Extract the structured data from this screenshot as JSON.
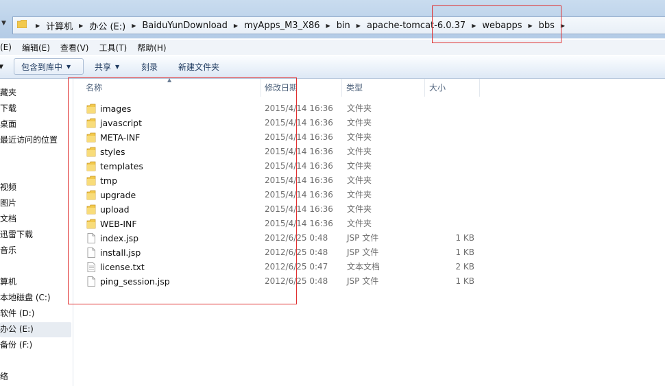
{
  "address": {
    "crumbs": [
      "计算机",
      "办公 (E:)",
      "BaiduYunDownload",
      "myApps_M3_X86",
      "bin",
      "apache-tomcat-6.0.37",
      "webapps",
      "bbs"
    ]
  },
  "menu": {
    "items": [
      "(E)",
      "编辑(E)",
      "查看(V)",
      "工具(T)",
      "帮助(H)"
    ]
  },
  "toolbar": {
    "include_library": "包含到库中",
    "share": "共享",
    "burn": "刻录",
    "new_folder": "新建文件夹"
  },
  "sidebar": {
    "items": [
      "藏夹",
      "下载",
      "桌面",
      "最近访问的位置",
      "",
      "视频",
      "图片",
      "文档",
      "迅雷下载",
      "音乐",
      "",
      "算机",
      "本地磁盘 (C:)",
      "软件 (D:)",
      "办公 (E:)",
      "备份 (F:)",
      "",
      "络"
    ]
  },
  "columns": {
    "name": "名称",
    "date": "修改日期",
    "type": "类型",
    "size": "大小"
  },
  "files": [
    {
      "name": "images",
      "date": "2015/4/14 16:36",
      "type": "文件夹",
      "size": "",
      "icon": "folder-icon"
    },
    {
      "name": "javascript",
      "date": "2015/4/14 16:36",
      "type": "文件夹",
      "size": "",
      "icon": "folder-icon"
    },
    {
      "name": "META-INF",
      "date": "2015/4/14 16:36",
      "type": "文件夹",
      "size": "",
      "icon": "folder-icon"
    },
    {
      "name": "styles",
      "date": "2015/4/14 16:36",
      "type": "文件夹",
      "size": "",
      "icon": "folder-icon"
    },
    {
      "name": "templates",
      "date": "2015/4/14 16:36",
      "type": "文件夹",
      "size": "",
      "icon": "folder-icon"
    },
    {
      "name": "tmp",
      "date": "2015/4/14 16:36",
      "type": "文件夹",
      "size": "",
      "icon": "folder-icon"
    },
    {
      "name": "upgrade",
      "date": "2015/4/14 16:36",
      "type": "文件夹",
      "size": "",
      "icon": "folder-icon"
    },
    {
      "name": "upload",
      "date": "2015/4/14 16:36",
      "type": "文件夹",
      "size": "",
      "icon": "folder-icon"
    },
    {
      "name": "WEB-INF",
      "date": "2015/4/14 16:36",
      "type": "文件夹",
      "size": "",
      "icon": "folder-icon"
    },
    {
      "name": "index.jsp",
      "date": "2012/6/25 0:48",
      "type": "JSP 文件",
      "size": "1 KB",
      "icon": "file-icon"
    },
    {
      "name": "install.jsp",
      "date": "2012/6/25 0:48",
      "type": "JSP 文件",
      "size": "1 KB",
      "icon": "file-icon"
    },
    {
      "name": "license.txt",
      "date": "2012/6/25 0:47",
      "type": "文本文档",
      "size": "2 KB",
      "icon": "text-file-icon"
    },
    {
      "name": "ping_session.jsp",
      "date": "2012/6/25 0:48",
      "type": "JSP 文件",
      "size": "1 KB",
      "icon": "file-icon"
    }
  ],
  "colors": {
    "annotation_red": "#e03030",
    "folder_yellow": "#f2c94c",
    "selected_bg": "#e7ecf2"
  }
}
